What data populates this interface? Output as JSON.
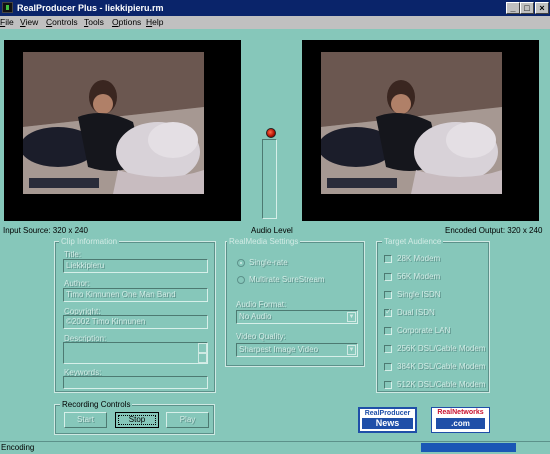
{
  "window": {
    "title": "RealProducer Plus - liekkipieru.rm",
    "buttons": {
      "minimize": "_",
      "maximize": "□",
      "close": "×"
    }
  },
  "menu": [
    {
      "label": "File",
      "accel": "F",
      "rest": "ile"
    },
    {
      "label": "View",
      "accel": "V",
      "rest": "iew"
    },
    {
      "label": "Controls",
      "accel": "C",
      "rest": "ontrols"
    },
    {
      "label": "Tools",
      "accel": "T",
      "rest": "ools"
    },
    {
      "label": "Options",
      "accel": "O",
      "rest": "ptions"
    },
    {
      "label": "Help",
      "accel": "H",
      "rest": "elp"
    }
  ],
  "video": {
    "input_label": "Input Source: 320 x 240",
    "audio_label": "Audio Level",
    "output_label": "Encoded Output: 320 x 240"
  },
  "clip_info": {
    "legend": "Clip Information",
    "title_label": "Title:",
    "title_value": "Liekkipieru",
    "author_label": "Author:",
    "author_value": "Timo Kinnunen One Man Band",
    "copyright_label": "Copyright:",
    "copyright_value": "©2002 Timo Kinnunen",
    "description_label": "Description:",
    "description_value": "",
    "keywords_label": "Keywords:",
    "keywords_value": ""
  },
  "realmedia": {
    "legend": "RealMedia Settings",
    "single_rate": "Single-rate",
    "multi_rate": "Multirate SureStream",
    "selected_mode": "single_rate",
    "audio_format_label": "Audio Format:",
    "audio_format_value": "No Audio",
    "video_quality_label": "Video Quality:",
    "video_quality_value": "Sharpest Image Video"
  },
  "target_audience": {
    "legend": "Target Audience",
    "options": [
      {
        "label": "28K Modem",
        "checked": false
      },
      {
        "label": "56K Modem",
        "checked": false
      },
      {
        "label": "Single ISDN",
        "checked": false
      },
      {
        "label": "Dual ISDN",
        "checked": true
      },
      {
        "label": "Corporate LAN",
        "checked": false
      },
      {
        "label": "256K DSL/Cable Modem",
        "checked": false
      },
      {
        "label": "384K DSL/Cable Modem",
        "checked": false
      },
      {
        "label": "512K DSL/Cable Modem",
        "checked": false
      }
    ]
  },
  "recording": {
    "legend": "Recording Controls",
    "start": "Start",
    "stop": "Stop",
    "play": "Play"
  },
  "logos": {
    "producer_top": "RealProducer",
    "producer_bottom": "News",
    "networks_top": "RealNetworks",
    "networks_bottom": ".com"
  },
  "status": {
    "text": "Encoding",
    "progress": 1.0
  },
  "colors": {
    "background": "#86c7ba",
    "titlebar": "#0a246a",
    "progress": "#1b57b5",
    "logo_blue": "#1f4fa8",
    "logo_red": "#c8102e"
  }
}
